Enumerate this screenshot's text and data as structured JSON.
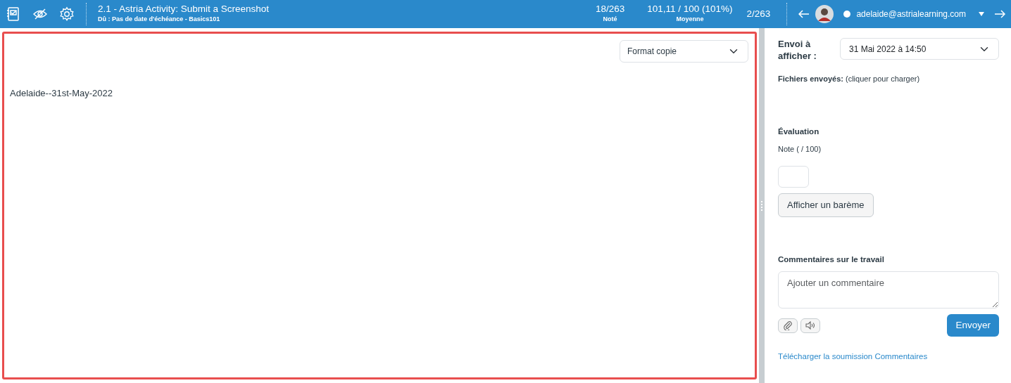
{
  "header": {
    "title": "2.1 - Astria Activity: Submit a Screenshot",
    "subtitle": "Dû : Pas de date d'échéance - Basics101",
    "stats": [
      {
        "value": "18/263",
        "label": "Noté"
      },
      {
        "value": "101,11 / 100 (101%)",
        "label": "Moyenne"
      }
    ],
    "position": "2/263",
    "student": "adelaide@astrialearning.com"
  },
  "viewer": {
    "format_select": "Format copie",
    "submission_text": "Adelaide--31st-May-2022",
    "highlighted": true
  },
  "sidebar": {
    "submission_label": "Envoi à afficher :",
    "submission_select": "31 Mai 2022 à 14:50",
    "files": "**Fichiers envoyés:** (cliquer pour charger)",
    "grading_heading": "Évaluation",
    "grade_label": "Note ( / 100)",
    "rubric_button": "Afficher un barème",
    "comments_heading": "Commentaires sur le travail",
    "comment_placeholder": "Ajouter un commentaire",
    "send_button": "Envoyer",
    "download_link": "Télécharger la soumission Commentaires"
  }
}
